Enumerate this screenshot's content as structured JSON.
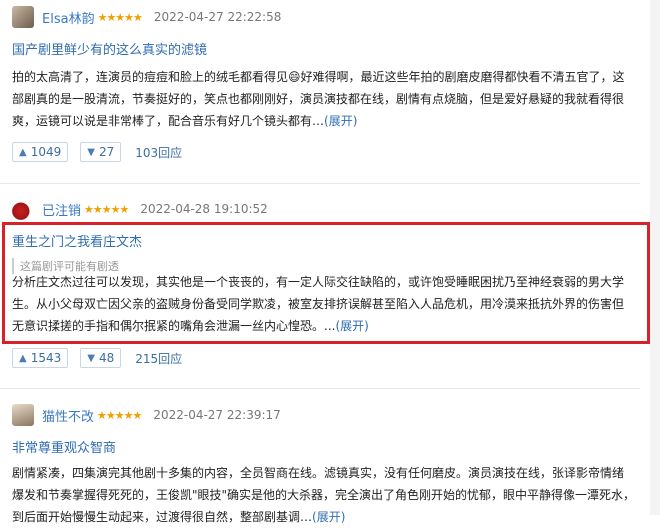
{
  "reviews": [
    {
      "user": "Elsa林韵",
      "stars": "★★★★★",
      "date": "2022-04-27 22:22:58",
      "title": "国产剧里鲜少有的这么真实的滤镜",
      "lines": [
        "拍的太高清了，连演员的痘痘和脸上的绒毛都看得见😄好难得啊，最近这些年拍的剧磨皮磨得都快看不清五官了，这",
        "部剧真的是一股清流，节奏挺好的，笑点也都刚刚好，演员演技都在线，剧情有点烧脑，但是爱好悬疑的我就看得很",
        "爽，运镜可以说是非常棒了，配合音乐有好几个镜头都有…"
      ],
      "more": "(展开)",
      "up": "1049",
      "down": "27",
      "replies": "103回应"
    },
    {
      "user": "已注销",
      "stars": "★★★★★",
      "date": "2022-04-28 19:10:52",
      "title": "重生之门之我看庄文杰",
      "warning": "这篇剧评可能有剧透",
      "lines": [
        "分析庄文杰过往可以发现，其实他是一个丧丧的，有一定人际交往缺陷的，或许饱受睡眠困扰乃至神经衰弱的男大学",
        "生。从小父母双亡因父亲的盗贼身份备受同学欺凌，被室友排挤误解甚至陷入人品危机，用冷漠来抵抗外界的伤害但",
        "无意识揉搓的手指和偶尔抿紧的嘴角会泄漏一丝内心惶恐。..."
      ],
      "more": "(展开)",
      "up": "1543",
      "down": "48",
      "replies": "215回应"
    },
    {
      "user": "猫性不改",
      "stars": "★★★★★",
      "date": "2022-04-27 22:39:17",
      "title": "非常尊重观众智商",
      "lines": [
        "剧情紧凑，四集演完其他剧十多集的内容，全员智商在线。滤镜真实，没有任何磨皮。演员演技在线，张译影帝情绪",
        "爆发和节奏掌握得死死的，王俊凯\"眼技\"确实是他的大杀器，完全演出了角色刚开始的忧郁，眼中平静得像一潭死水，",
        "到后面开始慢慢生动起来，过渡得很自然，整部剧基调…"
      ],
      "more": "(展开)"
    }
  ],
  "colors": {
    "link": "#2f6db0",
    "star": "#f0a000",
    "highlight_border": "#d8222a"
  },
  "icons": [
    "thumb-up-icon",
    "thumb-down-icon",
    "avatar"
  ]
}
